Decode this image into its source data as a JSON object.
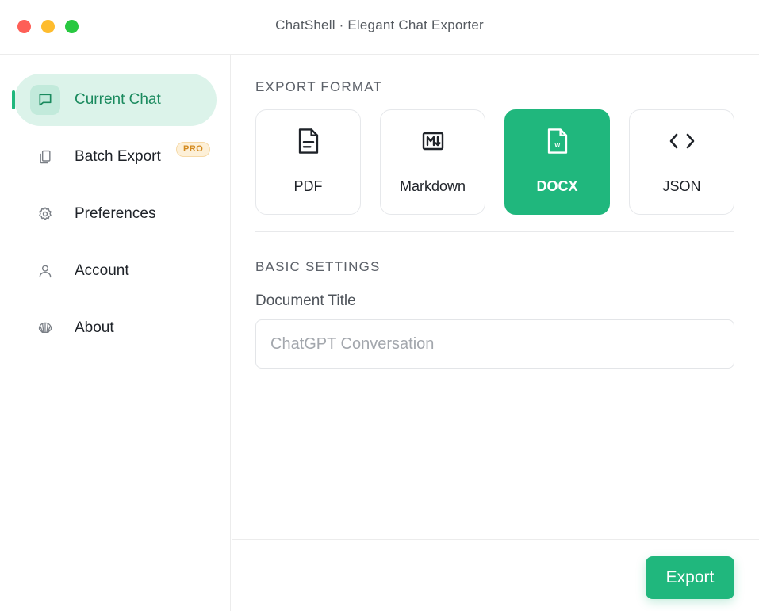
{
  "window": {
    "title": "ChatShell · Elegant Chat Exporter"
  },
  "sidebar": {
    "items": [
      {
        "label": "Current Chat",
        "icon": "chat-bubble-icon",
        "active": true
      },
      {
        "label": "Batch Export",
        "icon": "copy-icon",
        "badge": "PRO"
      },
      {
        "label": "Preferences",
        "icon": "gear-icon"
      },
      {
        "label": "Account",
        "icon": "user-icon"
      },
      {
        "label": "About",
        "icon": "shell-icon"
      }
    ]
  },
  "main": {
    "export_format": {
      "heading": "EXPORT FORMAT",
      "options": [
        {
          "label": "PDF",
          "icon": "file-text-icon"
        },
        {
          "label": "Markdown",
          "icon": "markdown-icon"
        },
        {
          "label": "DOCX",
          "icon": "word-file-icon",
          "selected": true
        },
        {
          "label": "JSON",
          "icon": "code-icon"
        }
      ]
    },
    "basic_settings": {
      "heading": "BASIC SETTINGS",
      "document_title_label": "Document Title",
      "document_title_value": "",
      "document_title_placeholder": "ChatGPT Conversation"
    }
  },
  "footer": {
    "export_label": "Export"
  },
  "colors": {
    "accent": "#20b77d",
    "accent_light": "#dcf3ea",
    "pro_badge": "#d38a1f"
  }
}
